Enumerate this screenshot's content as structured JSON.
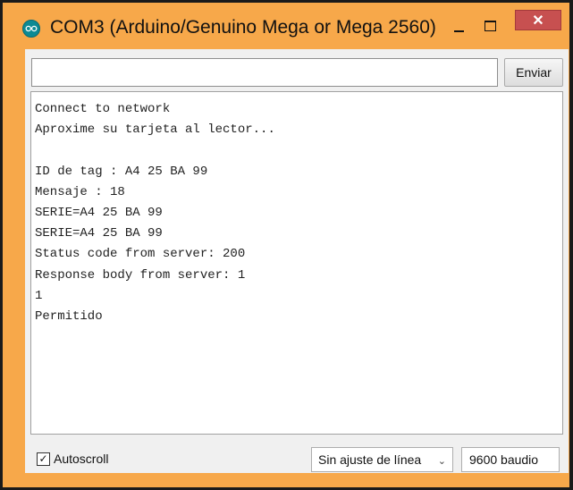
{
  "window": {
    "title": "COM3 (Arduino/Genuino Mega or Mega 2560)",
    "accent_color": "#f7a84a",
    "close_color": "#c75050",
    "icons": {
      "app": "arduino-logo-icon",
      "minimize": "minimize-icon",
      "maximize": "maximize-icon",
      "close": "close-icon"
    },
    "close_glyph": "✕"
  },
  "toolbar": {
    "input_value": "",
    "send_label": "Enviar"
  },
  "output": {
    "lines": [
      "Connect to network",
      "Aproxime su tarjeta al lector...",
      "",
      "ID de tag : A4 25 BA 99",
      "Mensaje : 18",
      "SERIE=A4 25 BA 99",
      "SERIE=A4 25 BA 99",
      "Status code from server: 200",
      "Response body from server: 1",
      "1",
      "Permitido"
    ]
  },
  "statusbar": {
    "autoscroll_label": "Autoscroll",
    "autoscroll_checked": true,
    "check_glyph": "✓",
    "line_ending": "Sin ajuste de línea",
    "dropdown_glyph": "⌄",
    "baud_rate": "9600 baudio"
  }
}
